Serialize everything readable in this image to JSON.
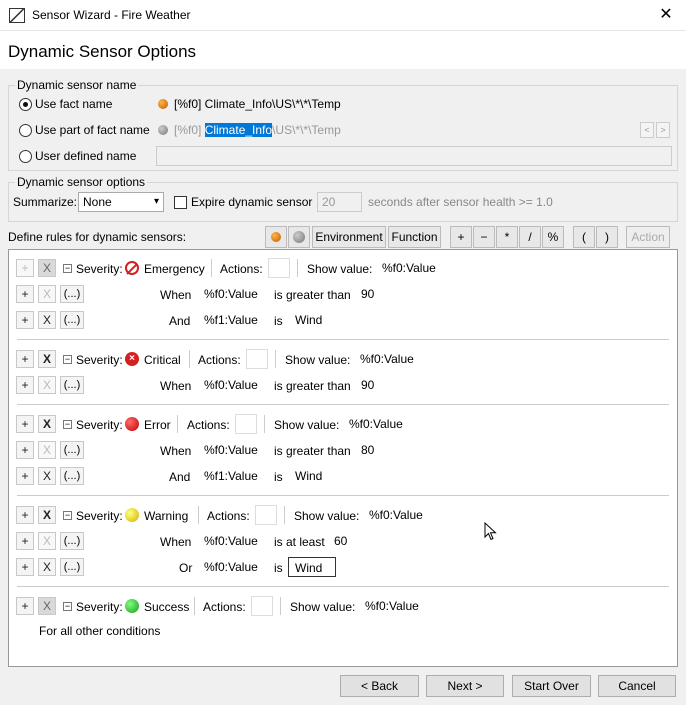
{
  "window": {
    "title": "Sensor Wizard - Fire Weather",
    "close_label": "✕"
  },
  "header": {
    "title": "Dynamic Sensor Options"
  },
  "name_group": {
    "title": "Dynamic sensor name",
    "options": [
      {
        "label": "Use fact name",
        "selected": true,
        "value": "[%f0] Climate_Info\\US\\*\\*\\Temp"
      },
      {
        "label": "Use part of fact name",
        "selected": false,
        "value_prefix": "[%f0] ",
        "value_selected": "Climate_Info",
        "value_suffix": "\\US\\*\\*\\Temp"
      },
      {
        "label": "User defined name",
        "selected": false,
        "value": ""
      }
    ],
    "prev_label": "<",
    "next_label": ">"
  },
  "options_group": {
    "title": "Dynamic sensor options",
    "summarize_label": "Summarize:",
    "summarize_value": "None",
    "expire_label": "Expire dynamic sensor",
    "expire_checked": false,
    "expire_value": "20",
    "expire_suffix": "seconds after sensor health >= 1.0"
  },
  "rules_toolbar": {
    "label": "Define rules for dynamic sensors:",
    "buttons": [
      "Environment",
      "Function",
      "+",
      "−",
      "*",
      "/",
      "%",
      "(",
      ")",
      "Action"
    ]
  },
  "rule_labels": {
    "add": "+",
    "remove": "X",
    "ellipsis": "(...)",
    "collapse": "−",
    "severity": "Severity:",
    "actions": "Actions:",
    "show_value": "Show value:"
  },
  "rules": [
    {
      "severity": "Emergency",
      "show_value": "%f0:Value",
      "conditions": [
        {
          "connector": "When",
          "operand": "%f0:Value",
          "operator": "is greater than",
          "value": "90"
        },
        {
          "connector": "And",
          "operand": "%f1:Value",
          "operator": "is",
          "value": "Wind"
        }
      ]
    },
    {
      "severity": "Critical",
      "show_value": "%f0:Value",
      "conditions": [
        {
          "connector": "When",
          "operand": "%f0:Value",
          "operator": "is greater than",
          "value": "90"
        }
      ]
    },
    {
      "severity": "Error",
      "show_value": "%f0:Value",
      "conditions": [
        {
          "connector": "When",
          "operand": "%f0:Value",
          "operator": "is greater than",
          "value": "80"
        },
        {
          "connector": "And",
          "operand": "%f1:Value",
          "operator": "is",
          "value": "Wind"
        }
      ]
    },
    {
      "severity": "Warning",
      "show_value": "%f0:Value",
      "conditions": [
        {
          "connector": "When",
          "operand": "%f0:Value",
          "operator": "is at least",
          "value": "60"
        },
        {
          "connector": "Or",
          "operand": "%f0:Value",
          "operator": "is",
          "value": "Wind"
        }
      ]
    },
    {
      "severity": "Success",
      "show_value": "%f0:Value",
      "note": "For all other conditions"
    }
  ],
  "footer": {
    "back": "< Back",
    "next": "Next >",
    "start_over": "Start Over",
    "cancel": "Cancel"
  }
}
